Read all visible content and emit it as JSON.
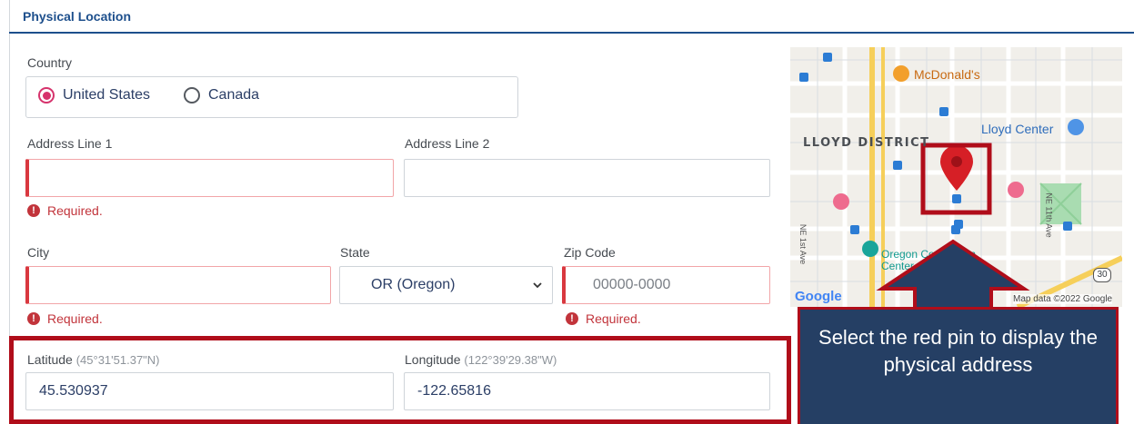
{
  "section": {
    "title": "Physical Location"
  },
  "country": {
    "label": "Country",
    "options": [
      {
        "label": "United States",
        "selected": true
      },
      {
        "label": "Canada",
        "selected": false
      }
    ]
  },
  "address": {
    "line1_label": "Address Line 1",
    "line1_value": "",
    "line1_error": "Required.",
    "line2_label": "Address Line 2",
    "line2_value": ""
  },
  "city": {
    "label": "City",
    "value": "",
    "error": "Required."
  },
  "state": {
    "label": "State",
    "value": "OR (Oregon)"
  },
  "zip": {
    "label": "Zip Code",
    "placeholder": "00000-0000",
    "error": "Required."
  },
  "latitude": {
    "label": "Latitude",
    "hint": "(45°31'51.37\"N)",
    "value": "45.530937"
  },
  "longitude": {
    "label": "Longitude",
    "hint": "(122°39'29.38\"W)",
    "value": "-122.65816"
  },
  "map": {
    "place_mcdonalds": "McDonald's",
    "place_lloyd_center": "Lloyd Center",
    "district": "LLOYD DISTRICT",
    "place_oregon_convention": "Oregon Convention Center",
    "street_ne1st": "NE 1st Ave",
    "street_ne11th": "NE 11th Ave",
    "route_shield": "30",
    "logo": "Google",
    "attribution": "Map data ©2022 Google",
    "pin_color": "#d61f26"
  },
  "callout": {
    "text": "Select the red pin to display the physical address"
  },
  "colors": {
    "accent": "#1d4f8c",
    "error": "#c2343b",
    "highlight": "#b00d1a",
    "callout_bg": "#253f64"
  }
}
